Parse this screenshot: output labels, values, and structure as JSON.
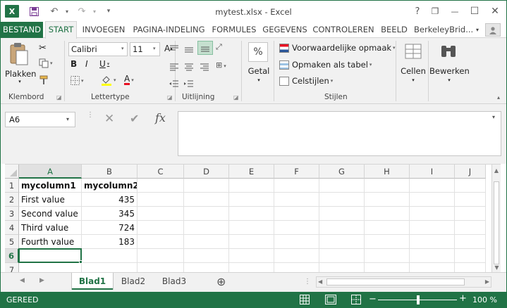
{
  "window": {
    "title": "mytest.xlsx - Excel"
  },
  "quick_access": {
    "save_icon": "save-icon",
    "undo_icon": "undo-icon",
    "redo_icon": "redo-icon",
    "customize_icon": "customize-icon"
  },
  "window_controls": {
    "help": "?",
    "restore": "❐",
    "minimize": "—",
    "maximize": "☐",
    "close": "✕"
  },
  "menu": {
    "file": "BESTAND",
    "tabs": [
      "START",
      "INVOEGEN",
      "PAGINA-INDELING",
      "FORMULES",
      "GEGEVENS",
      "CONTROLEREN",
      "BEELD",
      "BerkeleyBrid..."
    ],
    "active": "START"
  },
  "ribbon": {
    "clipboard": {
      "paste": "Plakken",
      "label": "Klembord"
    },
    "font": {
      "name": "Calibri",
      "size": "11",
      "bold": "B",
      "italic": "I",
      "underline": "U",
      "grow": "A",
      "shrink": "A",
      "label": "Lettertype"
    },
    "alignment": {
      "label": "Uitlijning"
    },
    "number": {
      "percent": "%",
      "name": "Getal"
    },
    "styles": {
      "conditional": "Voorwaardelijke opmaak",
      "table": "Opmaken als tabel",
      "cell_styles": "Celstijlen",
      "label": "Stijlen"
    },
    "cells": {
      "name": "Cellen"
    },
    "editing": {
      "name": "Bewerken"
    }
  },
  "formula_bar": {
    "name_box": "A6",
    "cancel": "✕",
    "enter": "✔",
    "fx": "fx",
    "value": ""
  },
  "grid": {
    "columns": [
      "A",
      "B",
      "C",
      "D",
      "E",
      "F",
      "G",
      "H",
      "I",
      "J"
    ],
    "rows": [
      "1",
      "2",
      "3",
      "4",
      "5",
      "6",
      "7"
    ],
    "cells": [
      [
        "mycolumn1",
        "mycolumn2"
      ],
      [
        "First value",
        "435"
      ],
      [
        "Second value",
        "345"
      ],
      [
        "Third value",
        "724"
      ],
      [
        "Fourth value",
        "183"
      ],
      [
        "",
        ""
      ],
      [
        "",
        ""
      ]
    ],
    "selected_cell": "A6"
  },
  "sheets": {
    "tabs": [
      "Blad1",
      "Blad2",
      "Blad3"
    ],
    "active": "Blad1",
    "add": "⊕"
  },
  "status": {
    "text": "GEREED",
    "zoom": "100 %",
    "minus": "−",
    "plus": "+"
  },
  "colors": {
    "accent": "#217346",
    "ribbon_bg": "#f1f1f1"
  }
}
